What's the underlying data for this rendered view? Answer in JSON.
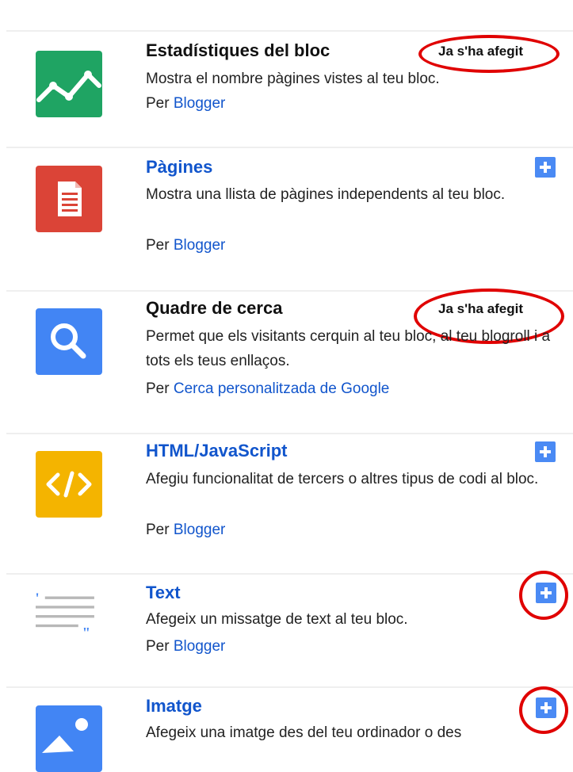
{
  "gadgets": [
    {
      "title": "Estadístiques del bloc",
      "description": "Mostra el nombre pàgines vistes al teu bloc.",
      "author_prefix": "Per",
      "author": "Blogger",
      "status": "Ja s'ha afegit",
      "icon": "stats-chart-icon",
      "icon_color": "#1fa463"
    },
    {
      "title": "Pàgines",
      "description": "Mostra una llista de pàgines independents al teu bloc.",
      "author_prefix": "Per",
      "author": "Blogger",
      "icon": "document-icon",
      "icon_color": "#db4437"
    },
    {
      "title": "Quadre de cerca",
      "description": "Permet que els visitants cerquin al teu bloc, al teu blogroll i a tots els teus enllaços.",
      "author_prefix": "Per",
      "author": "Cerca personalitzada de Google",
      "status": "Ja s'ha afegit",
      "icon": "search-icon",
      "icon_color": "#4285f4"
    },
    {
      "title": "HTML/JavaScript",
      "description": "Afegiu funcionalitat de tercers o altres tipus de codi al bloc.",
      "author_prefix": "Per",
      "author": "Blogger",
      "icon": "code-icon",
      "icon_color": "#f4b400"
    },
    {
      "title": "Text",
      "description": "Afegeix un missatge de text al teu bloc.",
      "author_prefix": "Per",
      "author": "Blogger",
      "icon": "text-quote-icon",
      "icon_color": "#9e9e9e"
    },
    {
      "title": "Imatge",
      "description": "Afegeix una imatge des del teu ordinador o des",
      "icon": "image-icon",
      "icon_color": "#4285f4"
    }
  ],
  "colors": {
    "link": "#1155cc",
    "add_button": "#4a8af4",
    "annotation": "#e00000"
  }
}
